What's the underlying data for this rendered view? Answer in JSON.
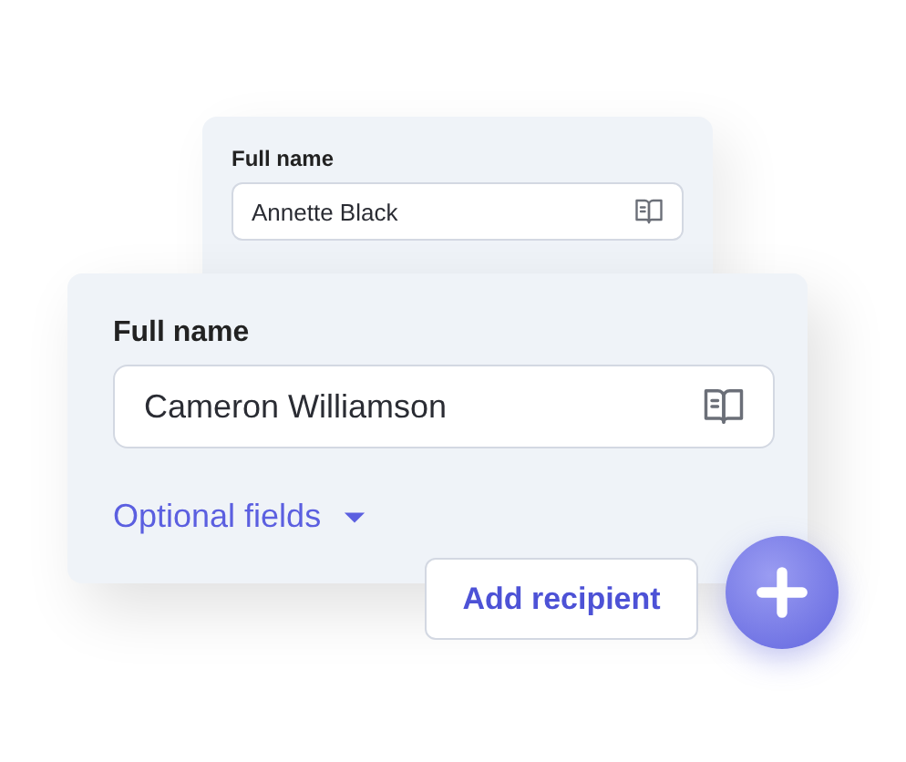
{
  "back_card": {
    "label": "Full name",
    "value": "Annette Black"
  },
  "front_card": {
    "label": "Full name",
    "value": "Cameron Williamson",
    "optional_fields": {
      "label": "Optional fields",
      "expanded": false
    }
  },
  "add_button": {
    "label": "Add recipient"
  }
}
